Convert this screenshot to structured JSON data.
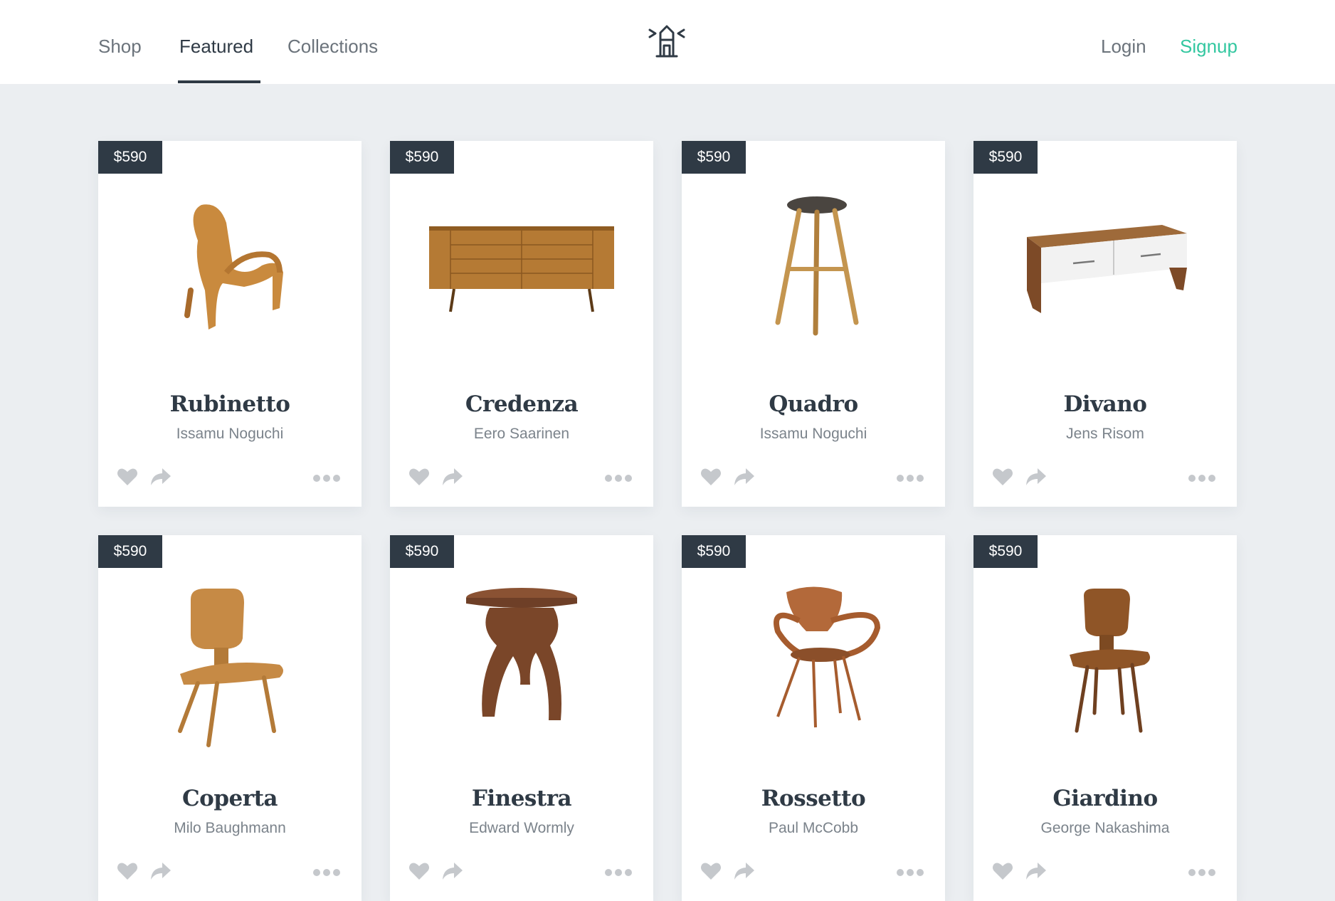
{
  "nav": {
    "shop": "Shop",
    "featured": "Featured",
    "collections": "Collections",
    "login": "Login",
    "signup": "Signup"
  },
  "logo_icon": "lighthouse-icon",
  "colors": {
    "accent": "#33c7a0",
    "dark": "#2f3a45",
    "muted": "#6b737b",
    "icon_gray": "#c5c8cc",
    "background": "#ebeef1"
  },
  "products": [
    {
      "price": "$590",
      "name": "Rubinetto",
      "designer": "Issamu Noguchi",
      "image": "plywood-lounge-chair"
    },
    {
      "price": "$590",
      "name": "Credenza",
      "designer": "Eero Saarinen",
      "image": "wooden-credenza"
    },
    {
      "price": "$590",
      "name": "Quadro",
      "designer": "Issamu Noguchi",
      "image": "bar-stool"
    },
    {
      "price": "$590",
      "name": "Divano",
      "designer": "Jens Risom",
      "image": "wooden-bench-drawers"
    },
    {
      "price": "$590",
      "name": "Coperta",
      "designer": "Milo Baughmann",
      "image": "molded-plywood-chair"
    },
    {
      "price": "$590",
      "name": "Finestra",
      "designer": "Edward Wormly",
      "image": "round-side-table"
    },
    {
      "price": "$590",
      "name": "Rossetto",
      "designer": "Paul McCobb",
      "image": "bentwood-armchair"
    },
    {
      "price": "$590",
      "name": "Giardino",
      "designer": "George Nakashima",
      "image": "walnut-dining-chair"
    }
  ],
  "card_actions": [
    "heart-icon",
    "share-icon",
    "more-icon"
  ]
}
